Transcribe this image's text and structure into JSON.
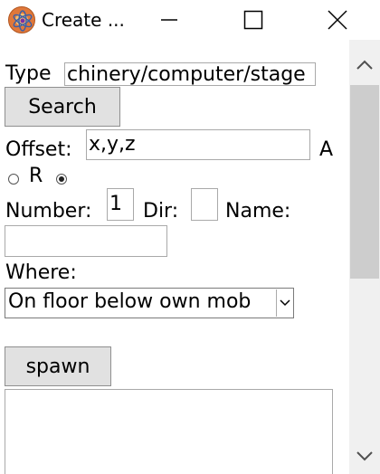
{
  "window": {
    "title": "Create ...",
    "icon": "app-logo-icon",
    "controls": {
      "minimize": "minimize-icon",
      "maximize": "maximize-icon",
      "close": "close-icon"
    }
  },
  "form": {
    "type_label": "Type",
    "type_value": "chinery/computer/stage",
    "search_button": "Search",
    "offset_label": "Offset:",
    "offset_value": "x,y,z",
    "radio_a_label": "A",
    "radio_r_label": "R",
    "radio_selected": "second",
    "number_label": "Number:",
    "number_value": "1",
    "dir_label": "Dir:",
    "dir_value": "",
    "name_label": "Name:",
    "name_value": "",
    "where_label": "Where:",
    "where_selected": "On floor below own mob",
    "spawn_button": "spawn",
    "output_value": ""
  },
  "scrollbar": {
    "up_icon": "chevron-up-icon",
    "down_icon": "chevron-down-icon"
  }
}
